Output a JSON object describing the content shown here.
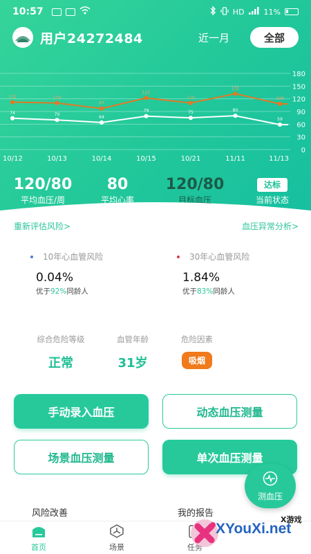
{
  "status_bar": {
    "time": "10:57",
    "network": "HD",
    "battery": "11%"
  },
  "header": {
    "user_name": "用户24272484",
    "range_label": "近一月",
    "all_button": "全部"
  },
  "chart_data": {
    "type": "line",
    "x": [
      "10/12",
      "10/13",
      "10/14",
      "10/15",
      "10/21",
      "11/11",
      "11/13"
    ],
    "yticks": [
      0,
      30,
      60,
      90,
      120,
      150,
      180
    ],
    "ylim": [
      0,
      180
    ],
    "series": [
      {
        "values": [
          112,
          110,
          97,
          122,
          110,
          132,
          108
        ],
        "color": "#e07a26"
      },
      {
        "values": [
          74,
          70,
          64,
          79,
          75,
          80,
          59
        ],
        "color": "#ffffff"
      }
    ]
  },
  "stats": {
    "avg_bp": {
      "value": "120/80",
      "label": "平均血压/周"
    },
    "avg_hr": {
      "value": "80",
      "label": "平均心率"
    },
    "target_bp": {
      "value": "120/80",
      "label": "目标血压"
    },
    "current_state": {
      "value": "达标",
      "label": "当前状态"
    }
  },
  "links": {
    "reassess": "重新评估风险>",
    "abnormal": "血压异常分析>"
  },
  "risk10": {
    "title": "10年心血管风险",
    "value": "0.04%",
    "note_prefix": "优于",
    "note_pct": "92%",
    "note_suffix": "同龄人",
    "dot_color": "#4a7bd8"
  },
  "risk30": {
    "title": "30年心血管风险",
    "value": "1.84%",
    "note_prefix": "优于",
    "note_pct": "83%",
    "note_suffix": "同龄人",
    "dot_color": "#d23c4a"
  },
  "levels": {
    "overall": {
      "label": "综合危险等级",
      "value": "正常"
    },
    "age": {
      "label": "血管年龄",
      "value": "31岁"
    },
    "factors": {
      "label": "危险因素",
      "value": "吸烟"
    }
  },
  "buttons": {
    "manual": "手动录入血压",
    "dynamic": "动态血压测量",
    "scene": "场景血压测量",
    "single": "单次血压测量"
  },
  "fab": {
    "label": "测血压"
  },
  "sections": {
    "risk_improve": "风险改善",
    "my_report": "我的报告"
  },
  "nav": {
    "home": "首页",
    "scene": "场景",
    "task": "任务"
  },
  "watermark": {
    "brand": "XYouXi.net",
    "small": "X游戏"
  },
  "colors": {
    "primary": "#27c99b",
    "accent_orange": "#f07a1c"
  }
}
